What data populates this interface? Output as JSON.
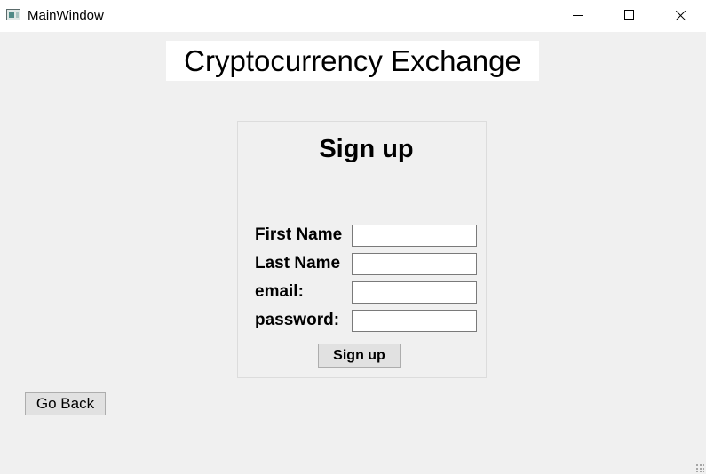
{
  "window": {
    "title": "MainWindow",
    "controls": [
      "minimize-icon",
      "maximize-icon",
      "close-icon"
    ]
  },
  "header": {
    "title": "Cryptocurrency Exchange"
  },
  "signup_form": {
    "title": "Sign up",
    "fields": [
      {
        "label": "First Name",
        "value": ""
      },
      {
        "label": "Last Name",
        "value": ""
      },
      {
        "label": "email:",
        "value": ""
      },
      {
        "label": "password:",
        "value": ""
      }
    ],
    "submit_label": "Sign up"
  },
  "navigation": {
    "back_label": "Go Back"
  },
  "colors": {
    "window_background": "#f0f0f0",
    "titlebar_background": "#ffffff",
    "button_background": "#e1e1e1"
  }
}
